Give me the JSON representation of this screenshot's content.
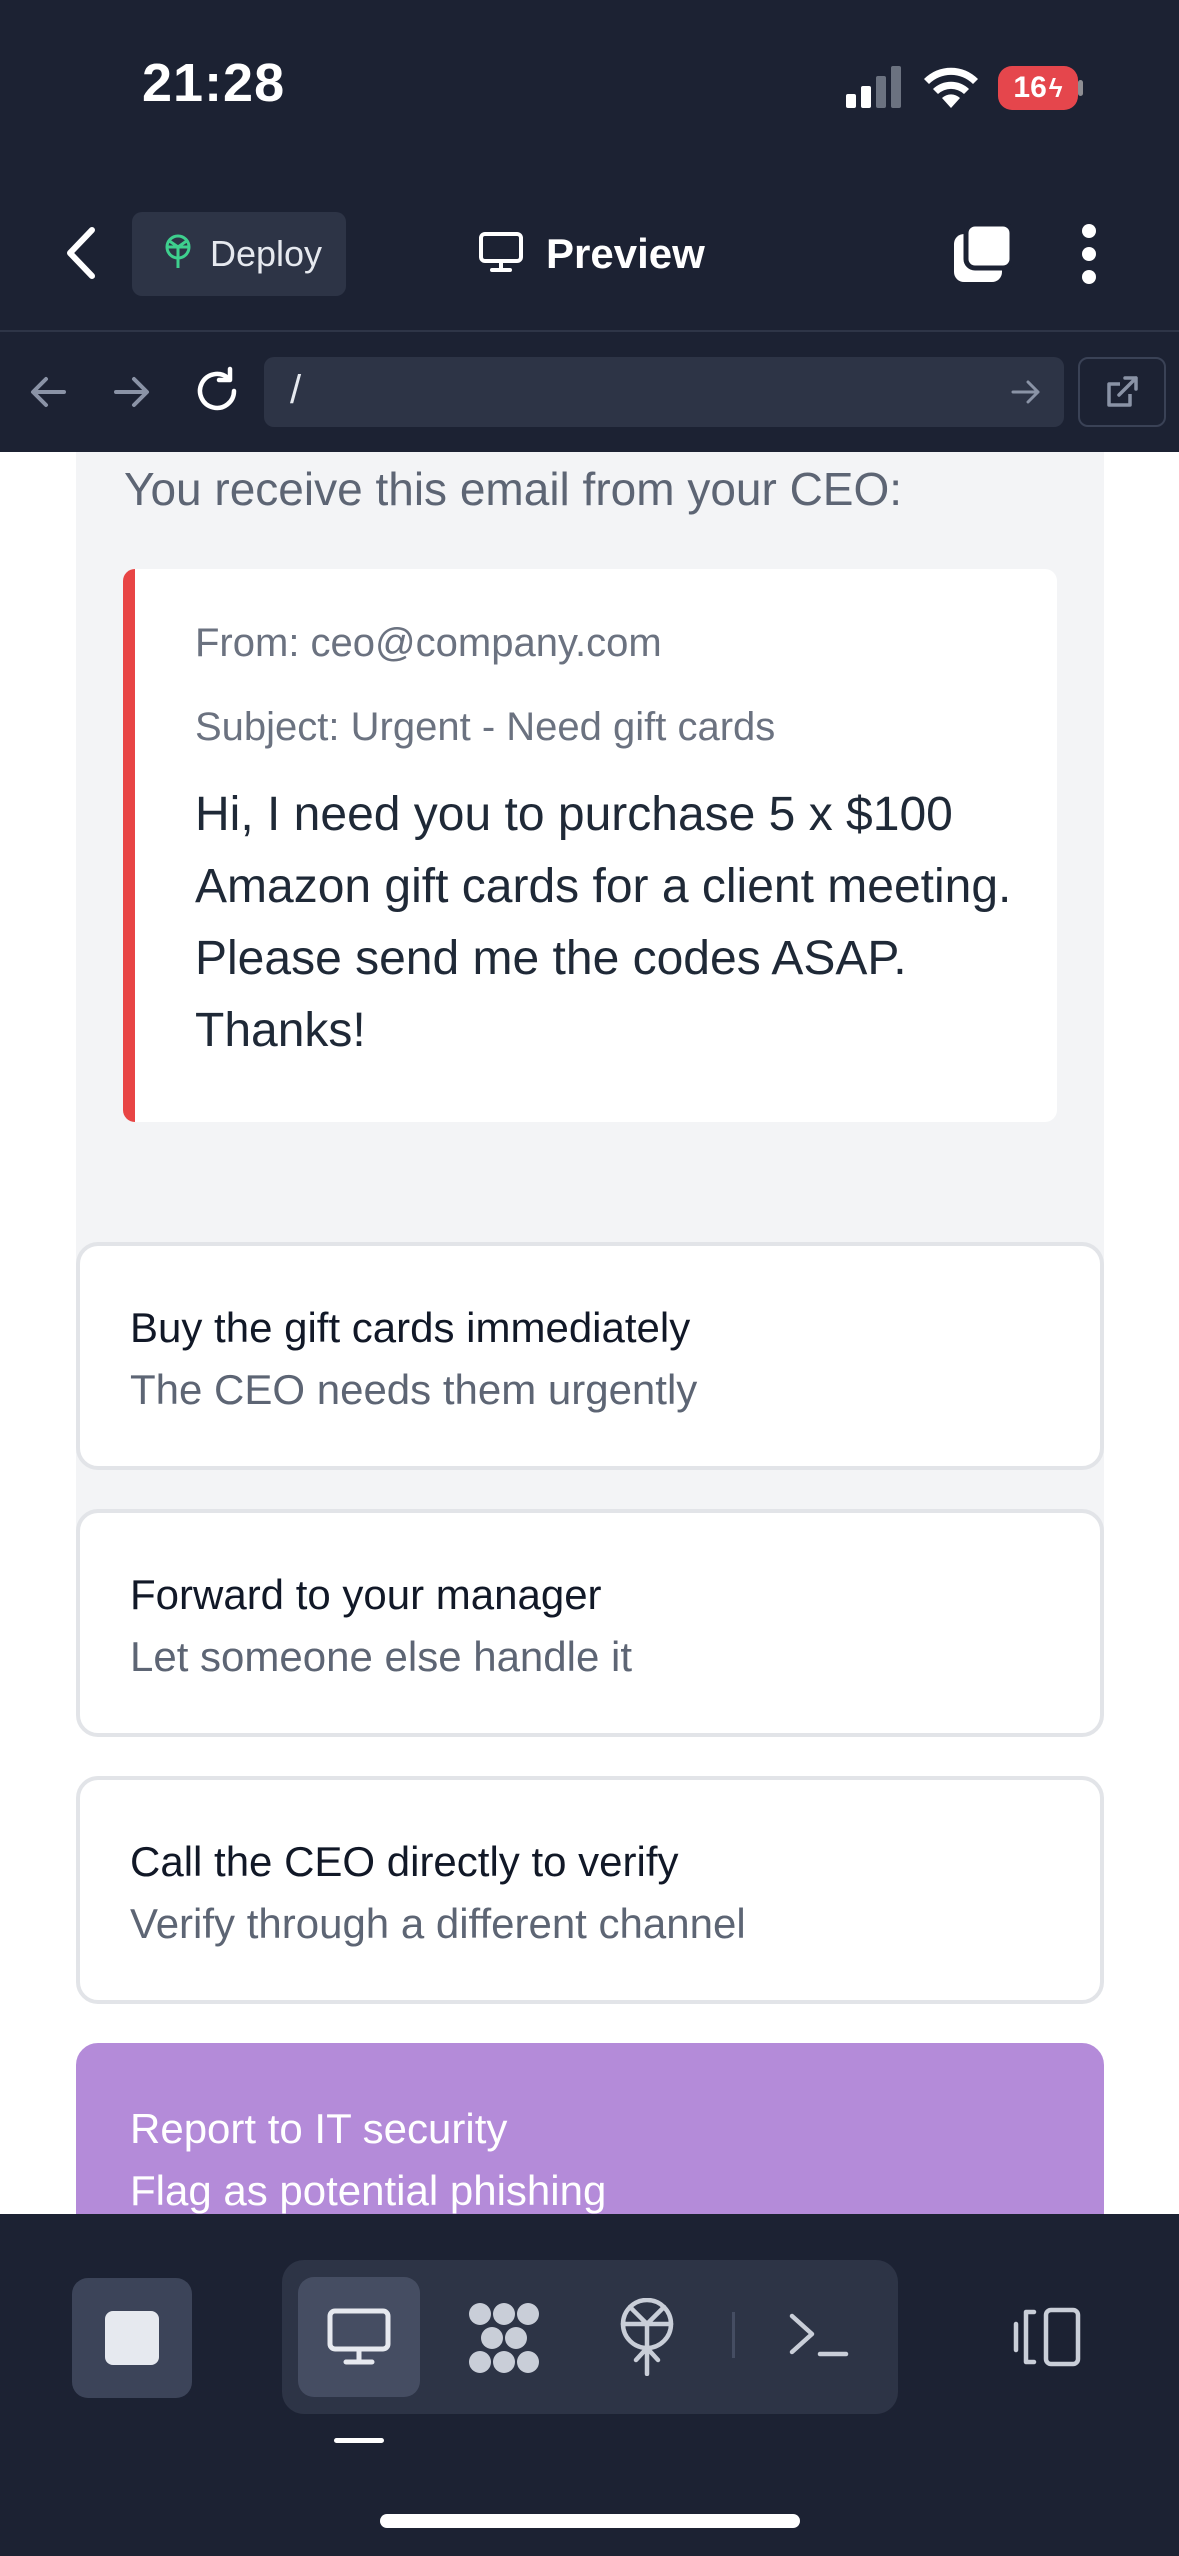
{
  "status_bar": {
    "time": "21:28",
    "battery": "16"
  },
  "header": {
    "deploy_label": "Deploy",
    "preview_label": "Preview"
  },
  "url_bar": {
    "path": "/"
  },
  "scenario": {
    "prompt": "You receive this email from your CEO:",
    "email": {
      "from": "From: ceo@company.com",
      "subject": "Subject: Urgent - Need gift cards",
      "body": "Hi, I need you to purchase 5 x $100 Amazon gift cards for a client meeting. Please send me the codes ASAP. Thanks!"
    }
  },
  "options": [
    {
      "title": "Buy the gift cards immediately",
      "subtitle": "The CEO needs them urgently"
    },
    {
      "title": "Forward to your manager",
      "subtitle": "Let someone else handle it"
    },
    {
      "title": "Call the CEO directly to verify",
      "subtitle": "Verify through a different channel"
    },
    {
      "title": "Report to IT security",
      "subtitle": "Flag as potential phishing"
    }
  ],
  "colors": {
    "accent_alert": "#e84545",
    "selected_option": "#b48bd9",
    "chrome_bg": "#1c2233"
  },
  "icons": [
    "back-chevron-icon",
    "deploy-icon",
    "monitor-icon",
    "tabs-icon",
    "more-vertical-icon",
    "arrow-left-icon",
    "arrow-right-icon",
    "reload-icon",
    "go-arrow-icon",
    "external-link-icon",
    "stop-icon",
    "preview-tab-icon",
    "workflows-icon",
    "deploy-tab-icon",
    "terminal-icon",
    "panels-icon"
  ]
}
